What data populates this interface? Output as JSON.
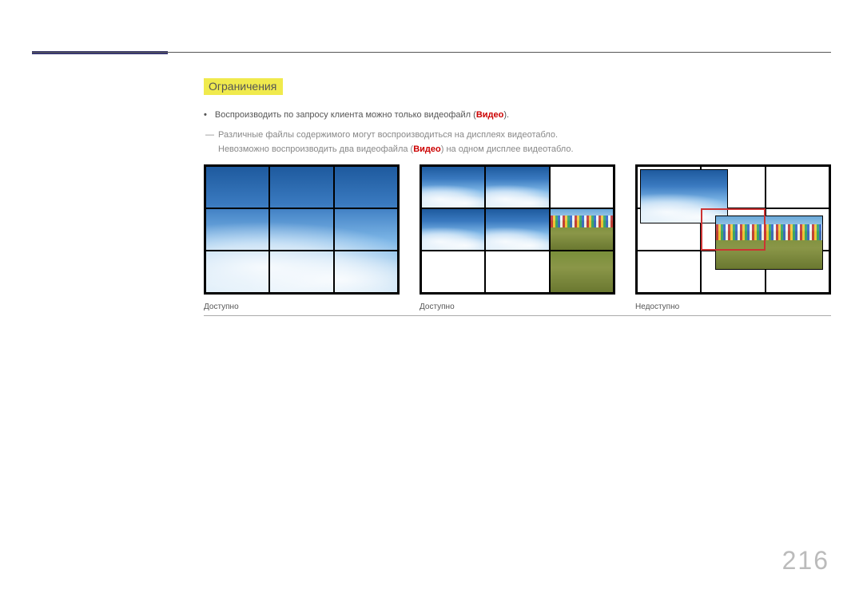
{
  "heading": "Ограничения",
  "bullet_text_prefix": "Воспроизводить по запросу клиента можно только видеофайл (",
  "bullet_text_keyword": "Видео",
  "bullet_text_suffix": ").",
  "note_line1": "Различные файлы содержимого могут воспроизводиться на дисплеях видеотабло.",
  "note_line2_prefix": "Невозможно воспроизводить два видеофайла (",
  "note_line2_keyword": "Видео",
  "note_line2_suffix": ") на одном дисплее видеотабло.",
  "captions": [
    "Доступно",
    "Доступно",
    "Недоступно"
  ],
  "page_number": "216"
}
